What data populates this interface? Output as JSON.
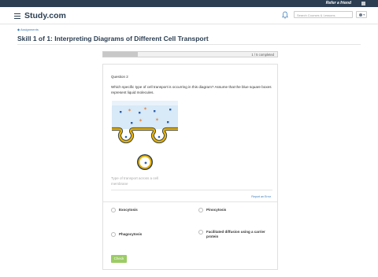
{
  "topbar": {
    "refer_label": "Refer a friend"
  },
  "header": {
    "logo_text": "Study.com",
    "search_placeholder": "Search Courses & Lessons"
  },
  "breadcrumb": {
    "label": "◆ Assignments"
  },
  "page": {
    "title": "Skill 1 of 1: Interpreting Diagrams of Different Cell Transport"
  },
  "progress": {
    "label": "1 / 5 completed",
    "completed": 1,
    "total": 5
  },
  "question": {
    "number_label": "Question 2",
    "text": "Which specific type of cell transport is occurring in this diagram? Assume that the blue square boxes represent liquid molecules.",
    "answer_placeholder": "Type of transport across a cell membrane",
    "report_label": "Report an Error"
  },
  "options": [
    {
      "label": "Exocytosis"
    },
    {
      "label": "Pinocytosis"
    },
    {
      "label": "Phagocytosis"
    },
    {
      "label": "Facilitated diffusion using a carrier protein"
    }
  ],
  "check_label": "Check",
  "colors": {
    "topbar": "#2b3e52",
    "accent": "#3a7bb8",
    "check": "#9ccc65",
    "membrane": "#e8b000",
    "fluid": "#d8e9f7",
    "star": "#e0803a",
    "molecule": "#2a5fb0"
  }
}
